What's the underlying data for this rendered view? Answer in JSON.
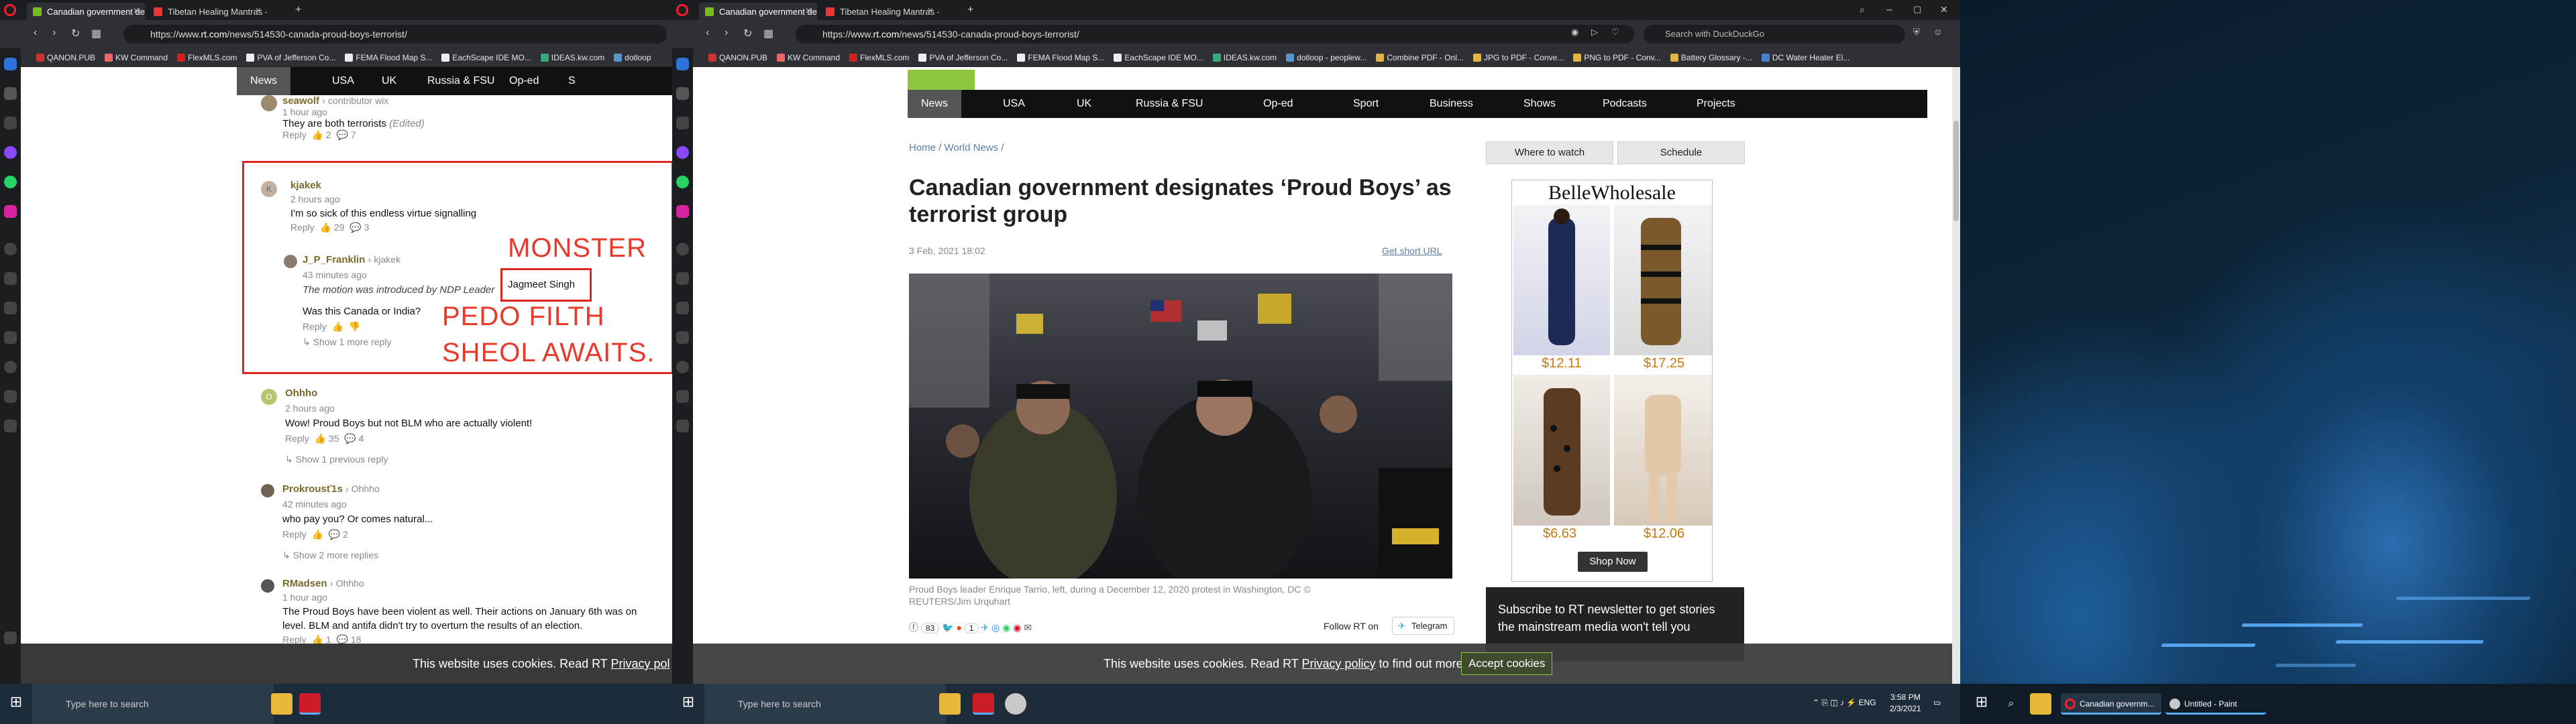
{
  "left_browser": {
    "tabs": [
      {
        "label": "Canadian government desi",
        "active": true
      },
      {
        "label": "Tibetan Healing Mantras -",
        "active": false
      }
    ],
    "url_prefix": "https://www.",
    "url_domain": "rt.com",
    "url_path": "/news/514530-canada-proud-boys-terrorist/",
    "bookmarks": [
      "QANON.PUB",
      "KW Command",
      "FlexMLS.com",
      "PVA of Jefferson Co...",
      "FEMA Flood Map S...",
      "EachScape IDE MO...",
      "IDEAS.kw.com",
      "dotloop"
    ],
    "nav": [
      "News",
      "USA",
      "UK",
      "Russia & FSU",
      "Op-ed",
      "S"
    ],
    "comments": [
      {
        "name": "seawolf",
        "reply_to": "contributor wix",
        "time": "1 hour ago",
        "text": "They are both terrorists",
        "edited": "(Edited)",
        "reply": "Reply",
        "up": "2",
        "replies": "7"
      },
      {
        "name": "kjakek",
        "reply_to": "",
        "time": "2 hours ago",
        "text": "I'm so sick of this endless virtue signalling",
        "reply": "Reply",
        "up": "29",
        "replies": "3"
      },
      {
        "name": "J_P_Franklin",
        "reply_to": "kjakek",
        "time": "43 minutes ago",
        "text": "The motion was introduced by NDP Leader",
        "highlight": "Jagmeet Singh",
        "text2": "Was this Canada or India?",
        "reply": "Reply",
        "more": "Show 1 more reply"
      },
      {
        "name": "Ohhho",
        "reply_to": "",
        "time": "2 hours ago",
        "text": "Wow! Proud Boys but not BLM who are actually violent!",
        "reply": "Reply",
        "up": "35",
        "replies": "4",
        "more": "Show 1 previous reply"
      },
      {
        "name": "Prokrousť1s",
        "reply_to": "Ohhho",
        "time": "42 minutes ago",
        "text": "who pay you? Or comes natural...",
        "reply": "Reply",
        "replies": "2",
        "more": "Show 2 more replies"
      },
      {
        "name": "RMadsen",
        "reply_to": "Ohhho",
        "time": "1 hour ago",
        "text": "The Proud Boys have been violent as well. Their actions on January 6th was on",
        "text2": "level. BLM and antifa didn't try to overturn the results of an election.",
        "reply": "Reply",
        "up": "1",
        "replies": "18"
      }
    ],
    "annotation_1": "MONSTER",
    "annotation_2": "PEDO FILTH",
    "annotation_3": "SHEOL AWAITS.",
    "cookie_text": "This website uses cookies. Read RT",
    "cookie_link": "Privacy pol"
  },
  "right_browser": {
    "tabs": [
      {
        "label": "Canadian government desi",
        "active": true
      },
      {
        "label": "Tibetan Healing Mantras -",
        "active": false
      }
    ],
    "url_prefix": "https://www.",
    "url_domain": "rt.com",
    "url_path": "/news/514530-canada-proud-boys-terrorist/",
    "search_placeholder": "Search with DuckDuckGo",
    "bookmarks": [
      "QANON.PUB",
      "KW Command",
      "FlexMLS.com",
      "PVA of Jefferson Co...",
      "FEMA Flood Map S...",
      "EachScape IDE MO...",
      "IDEAS.kw.com",
      "dotloop - peoplew...",
      "Combine PDF - Onl...",
      "JPG to PDF - Conve...",
      "PNG to PDF - Conv...",
      "Battery Glossary -...",
      "DC Water Heater El..."
    ],
    "nav": [
      "News",
      "USA",
      "UK",
      "Russia & FSU",
      "Op-ed",
      "Sport",
      "Business",
      "Shows",
      "Podcasts",
      "Projects"
    ],
    "breadcrumb": [
      "Home",
      "World News"
    ],
    "headline": "Canadian government designates ‘Proud Boys’ as terrorist group",
    "date": "3 Feb, 2021 18:02",
    "short_url": "Get short URL",
    "caption": "Proud Boys leader Enrique Tarrio, left, during a December 12, 2020 protest in Washington, DC © REUTERS/Jim Urquhart",
    "share_count_1": "83",
    "share_count_2": "1",
    "follow_label": "Follow RT on",
    "telegram": "Telegram",
    "where_to_watch": "Where to watch",
    "schedule": "Schedule",
    "ad_brand": "BelleWholesale",
    "ad_prices": [
      "$12.11",
      "$17.25",
      "$6.63",
      "$12.06"
    ],
    "ad_button": "Shop Now",
    "newsletter": "Subscribe to RT newsletter to get stories the mainstream media won't tell you",
    "cookie_text": "This website uses cookies. Read RT",
    "cookie_link": "Privacy policy",
    "cookie_text2": "to find out more.",
    "accept": "Accept cookies"
  },
  "taskbar": {
    "search_placeholder_left": "Type here to search",
    "search_placeholder_right": "Type here to search",
    "time": "3:58 PM",
    "date": "2/3/2021",
    "apps": [
      "Canadian governm...",
      "Untitled - Paint"
    ]
  }
}
